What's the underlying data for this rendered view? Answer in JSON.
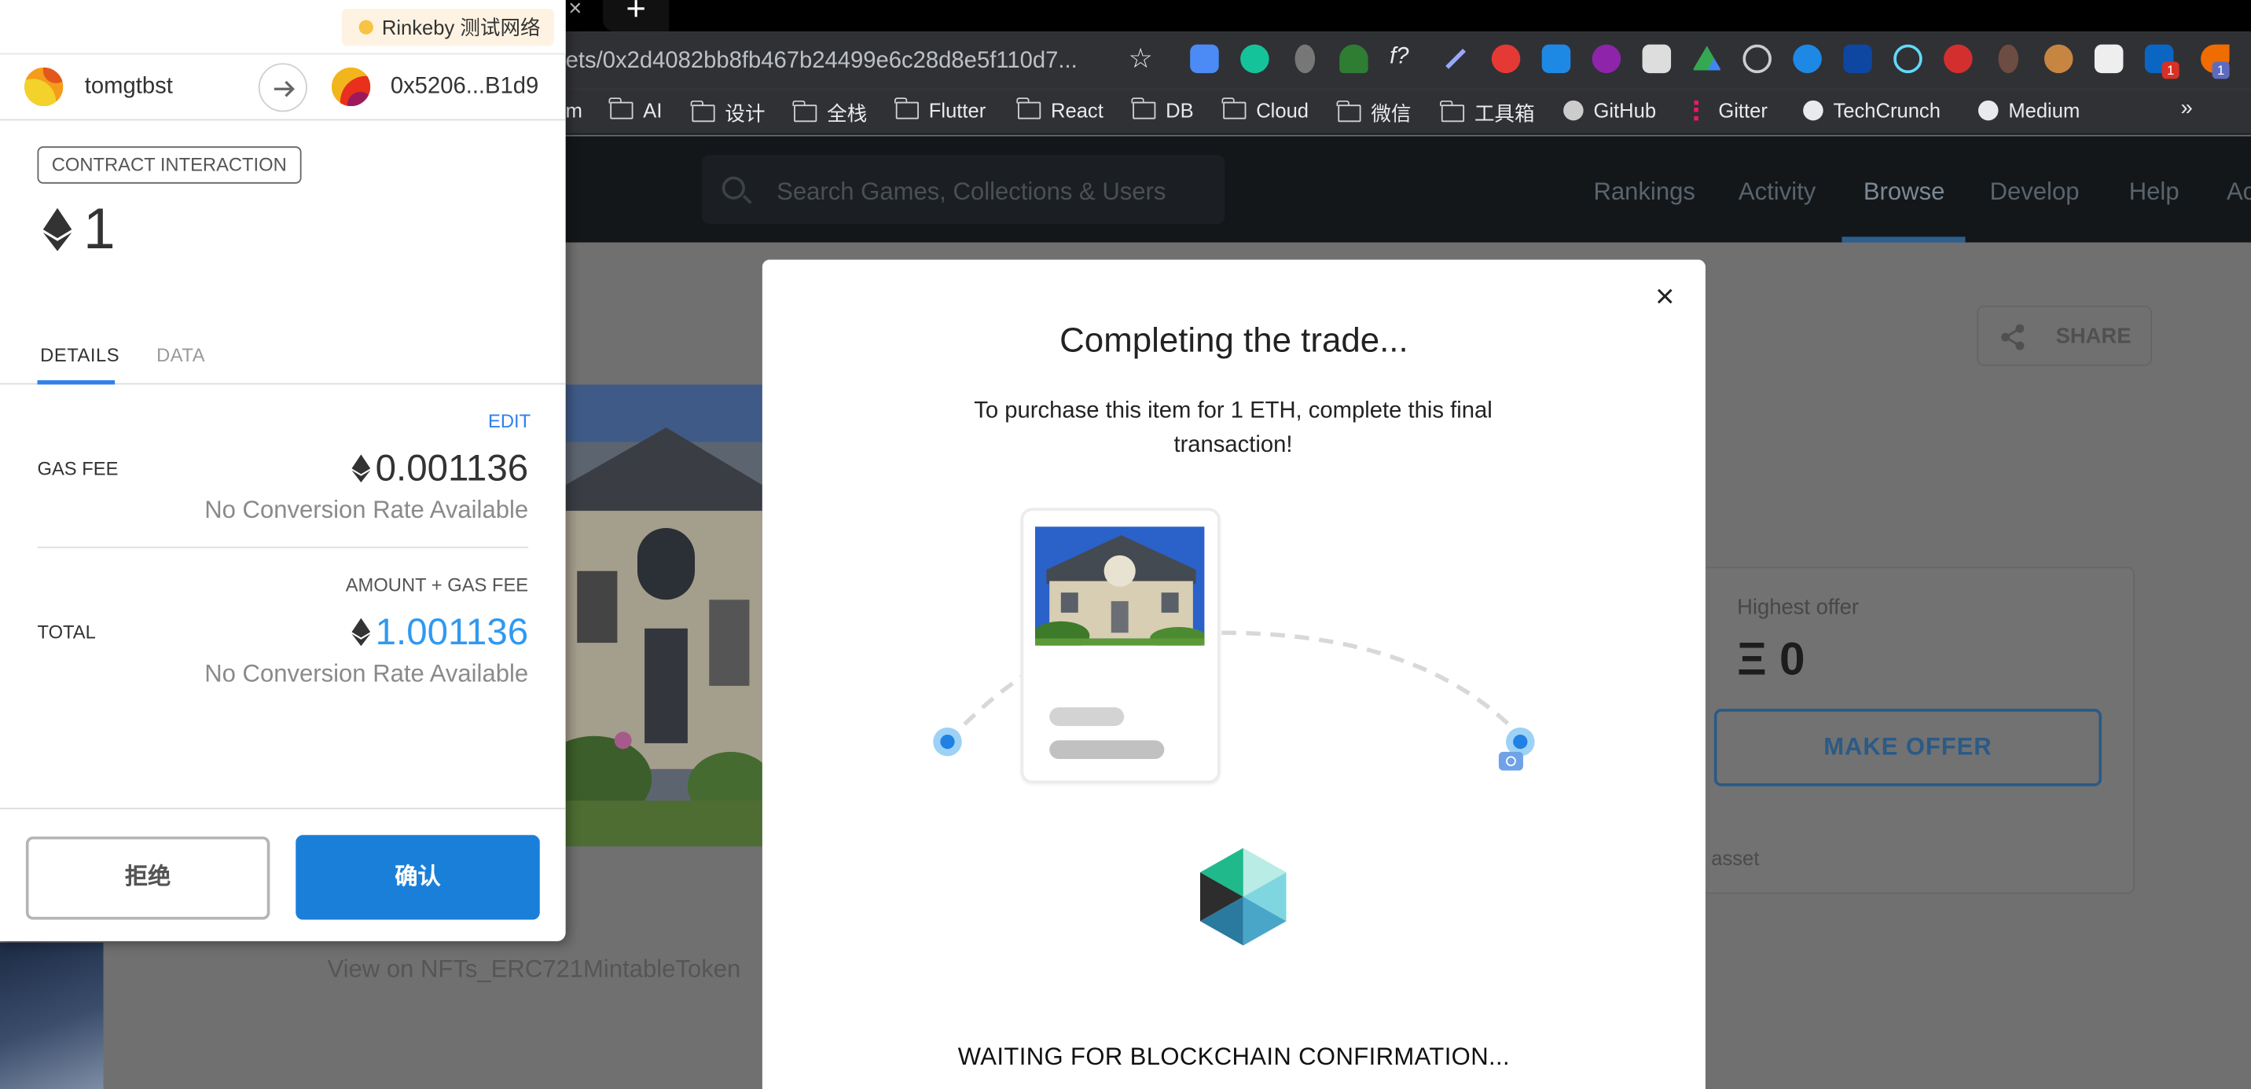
{
  "browser": {
    "url": "ets/0x2d4082bb8fb467b24499e6c28d8e5f110d7...",
    "bookmarks": [
      "m",
      "AI",
      "设计",
      "全栈",
      "Flutter",
      "React",
      "DB",
      "Cloud",
      "微信",
      "工具箱",
      "GitHub",
      "Gitter",
      "TechCrunch",
      "Medium"
    ],
    "bookmarks_more": "»",
    "new_tab": "+",
    "tab_close": "×",
    "ext_badges": [
      "1",
      "1"
    ]
  },
  "site": {
    "search_placeholder": "Search Games, Collections & Users",
    "nav": [
      "Rankings",
      "Activity",
      "Browse",
      "Develop",
      "Help",
      "Ac"
    ],
    "share_label": "SHARE",
    "highest_offer_label": "Highest offer",
    "highest_offer_value": "Ξ 0",
    "make_offer_label": "MAKE OFFER",
    "asset_text": "is asset",
    "view_on_text": "View on NFTs_ERC721MintableToken"
  },
  "modal": {
    "title": "Completing the trade...",
    "description": "To purchase this item for 1 ETH, complete this final transaction!",
    "status": "WAITING FOR BLOCKCHAIN CONFIRMATION...",
    "close": "×"
  },
  "metamask": {
    "network": "Rinkeby 测试网络",
    "from_account": "tomgtbst",
    "to_address": "0x5206...B1d9",
    "interaction_type": "CONTRACT INTERACTION",
    "amount": "1",
    "tabs": [
      "DETAILS",
      "DATA"
    ],
    "edit_label": "EDIT",
    "gas_fee_label": "GAS FEE",
    "gas_fee_value": "0.001136",
    "no_conversion": "No Conversion Rate Available",
    "amount_plus_gas_label": "AMOUNT + GAS FEE",
    "total_label": "TOTAL",
    "total_value": "1.001136",
    "reject_label": "拒绝",
    "confirm_label": "确认"
  },
  "colors": {
    "metamask_blue": "#1a7fd9",
    "total_blue": "#3099f2",
    "opensea_blue": "#2081e2"
  }
}
